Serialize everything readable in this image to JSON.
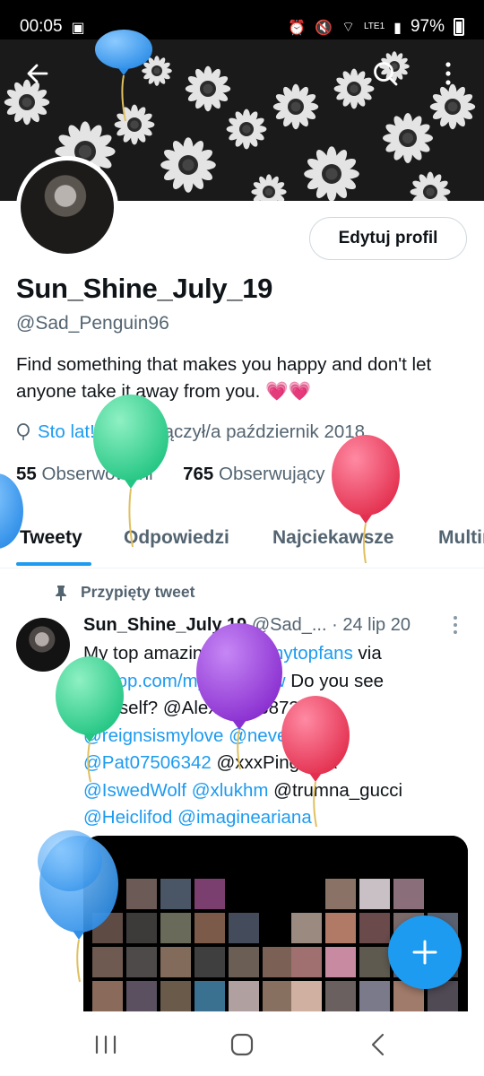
{
  "status_bar": {
    "time": "00:05",
    "battery": "97%",
    "network": "LTE1"
  },
  "header": {
    "back_icon": "arrow-left-icon",
    "search_icon": "search-icon",
    "more_icon": "more-vertical-icon"
  },
  "profile": {
    "edit_button": "Edytuj profil",
    "display_name": "Sun_Shine_July_19",
    "handle": "@Sad_Penguin96",
    "bio_text": "Find something that makes you happy and don't let anyone take it away from you.",
    "bio_emoji": "💗💗",
    "birthday_label": "Sto lat!",
    "joined_label": "Dołączył/a październik 2018",
    "following_count": "55",
    "following_label": "Obserwowani",
    "followers_count": "765",
    "followers_label": "Obserwujący"
  },
  "tabs": [
    "Tweety",
    "Odpowiedzi",
    "Najciekawsze",
    "Multimedia"
  ],
  "pinned_tweet": {
    "pinned_label": "Przypięty tweet",
    "author_name": "Sun_Shine_July 19",
    "author_handle": "@Sad_...",
    "date": "· 24 lip 20",
    "line1_text": "My top amazing fans ",
    "line1_tag": "#mytopfans",
    "line1_end": " via",
    "line2_link": "dixapp.com/mytopfanstw",
    "line2_text": " Do you see",
    "line3_text": "yourself? @Alex88193873",
    "line4_a": "@reignsismylove",
    "line4_b": " @never_l_and",
    "line5_a": "@Pat07506342",
    "line5_b": " @xxxPinguxxx",
    "line6_a": "@IswedWolf",
    "line6_b": " @xlukhm",
    "line6_c": " @trumna_gucci",
    "line7_a": "@Heiclifod",
    "line7_b": " @imagineariana"
  },
  "colors": {
    "accent": "#1d9bf0",
    "text": "#0f1419",
    "muted": "#536471",
    "balloon_green": "#3ddc97",
    "balloon_pink": "#f0506e",
    "balloon_purple": "#9b3fd9",
    "balloon_blue": "#3fa2f5"
  },
  "fab_icon": "plus-icon",
  "nav": {
    "recents_icon": "recents-icon",
    "home_icon": "home-icon",
    "back_icon": "back-chevron-icon"
  }
}
